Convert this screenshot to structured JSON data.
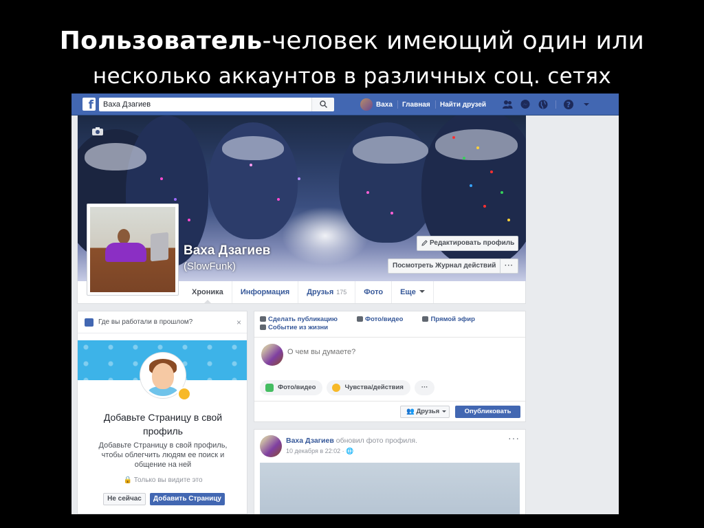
{
  "slide": {
    "title_bold": "Пользователь",
    "title_rest": "-человек имеющий один или",
    "title_line2": "несколько аккаунтов в различных соц. сетях"
  },
  "topbar": {
    "logo": "f",
    "search_value": "Ваха Дзагиев",
    "user_name": "Ваха",
    "home": "Главная",
    "find_friends": "Найти друзей",
    "icons": [
      "friends-icon",
      "messages-icon",
      "globe-icon",
      "help-icon",
      "caret-icon"
    ],
    "brand_color": "#4267b2"
  },
  "profile": {
    "name": "Ваха Дзагиев",
    "nickname": "(SlowFunk)",
    "edit_profile": "Редактировать профиль",
    "activity_log": "Посмотреть Журнал действий",
    "more": "···",
    "tabs": [
      {
        "label": "Хроника"
      },
      {
        "label": "Информация"
      },
      {
        "label": "Друзья",
        "count": "175"
      },
      {
        "label": "Фото"
      },
      {
        "label": "Еще"
      }
    ]
  },
  "left_card": {
    "question": "Где вы работали в прошлом?",
    "close": "×",
    "title": "Добавьте Страницу в свой профиль",
    "description": "Добавьте Страницу в свой профиль, чтобы облегчить людям ее поиск и общение на ней",
    "privacy": "Только вы видите это",
    "not_now": "Не сейчас",
    "add_page": "Добавить Страницу"
  },
  "composer": {
    "tabs": [
      "Сделать публикацию",
      "Фото/видео",
      "Прямой эфир",
      "Событие из жизни"
    ],
    "placeholder": "О чем вы думаете?",
    "pills": [
      "Фото/видео",
      "Чувства/действия",
      "···"
    ],
    "audience": "Друзья",
    "publish": "Опубликовать"
  },
  "post": {
    "author": "Ваха Дзагиев",
    "action": "обновил фото профиля.",
    "time": "10 декабря в 22:02 ·",
    "more": "···"
  }
}
